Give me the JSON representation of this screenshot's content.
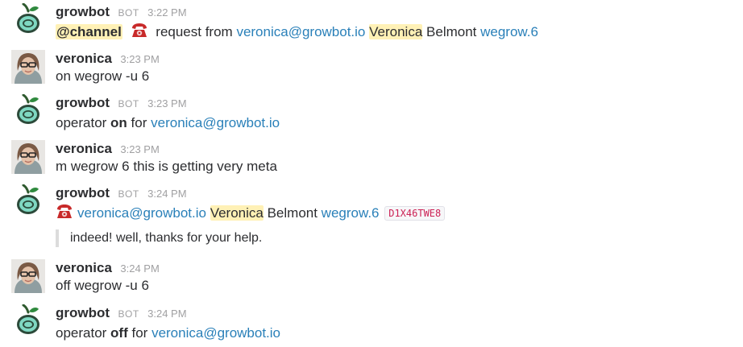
{
  "colors": {
    "link": "#2a80b9",
    "highlight": "#fff1b6",
    "code_text": "#cc2255",
    "muted": "#a0a0a2"
  },
  "icons": {
    "bot_avatar": "growbot-apple-logo",
    "user_avatar": "veronica-photo",
    "phone": "telephone-emoji"
  },
  "messages": [
    {
      "author": "growbot",
      "bot_label": "BOT",
      "time": "3:22 PM",
      "text": {
        "channel": "@channel",
        "t1": " request from ",
        "email": "veronica@growbot.io",
        "first": "Veronica",
        "last": " Belmont ",
        "team": "wegrow.6"
      }
    },
    {
      "author": "veronica",
      "time": "3:23 PM",
      "text": "on wegrow -u 6"
    },
    {
      "author": "growbot",
      "bot_label": "BOT",
      "time": "3:23 PM",
      "text": {
        "pre": "operator ",
        "state": "on",
        "mid": " for ",
        "email": "veronica@growbot.io"
      }
    },
    {
      "author": "veronica",
      "time": "3:23 PM",
      "text": "m wegrow 6 this is getting very meta"
    },
    {
      "author": "growbot",
      "bot_label": "BOT",
      "time": "3:24 PM",
      "text": {
        "email": "veronica@growbot.io",
        "first": "Veronica",
        "last": " Belmont ",
        "team": "wegrow.6",
        "code": "D1X46TWE8"
      },
      "quote": "indeed! well, thanks for your help."
    },
    {
      "author": "veronica",
      "time": "3:24 PM",
      "text": "off wegrow -u 6"
    },
    {
      "author": "growbot",
      "bot_label": "BOT",
      "time": "3:24 PM",
      "text": {
        "pre": "operator ",
        "state": "off",
        "mid": " for ",
        "email": "veronica@growbot.io"
      }
    }
  ]
}
